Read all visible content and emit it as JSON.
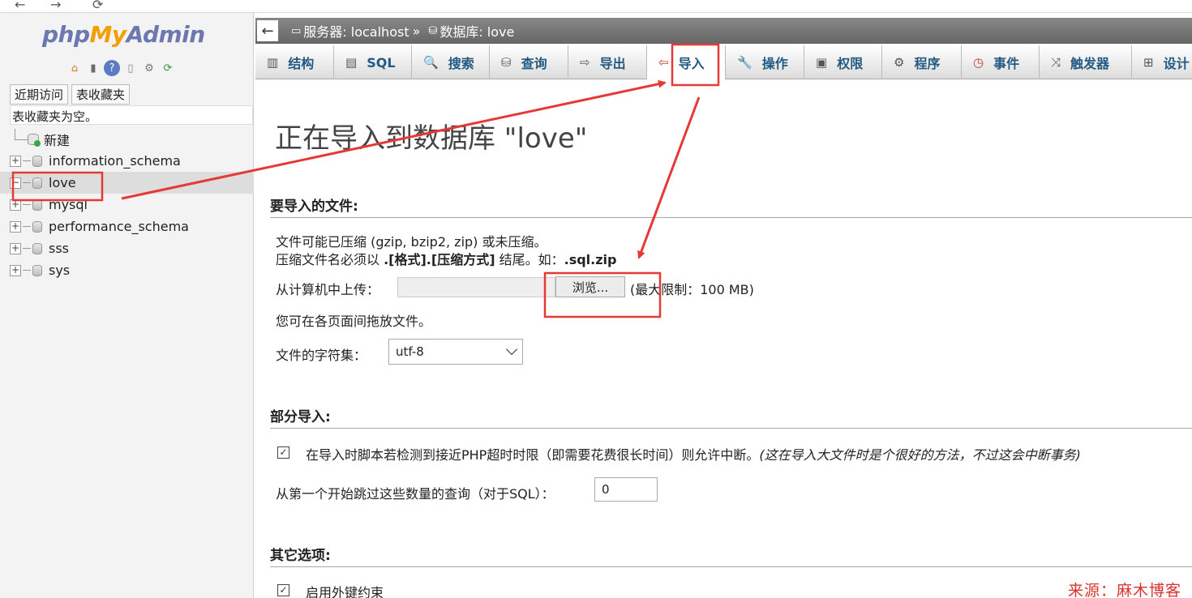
{
  "browser": {
    "back": "←",
    "forward": "→",
    "reload": "⟳"
  },
  "nav": {
    "logo": {
      "php": "php",
      "my": "My",
      "admin": "Admin"
    },
    "icons": [
      "home-icon",
      "logout-icon",
      "help-icon",
      "docs-icon",
      "settings-icon",
      "reload-icon"
    ],
    "tabs": [
      "近期访问",
      "表收藏夹"
    ],
    "favorites_empty": "表收藏夹为空。",
    "tree": [
      {
        "label": "新建",
        "type": "new"
      },
      {
        "label": "information_schema",
        "type": "db"
      },
      {
        "label": "love",
        "type": "db",
        "selected": true
      },
      {
        "label": "mysql",
        "type": "db"
      },
      {
        "label": "performance_schema",
        "type": "db"
      },
      {
        "label": "sss",
        "type": "db"
      },
      {
        "label": "sys",
        "type": "db"
      }
    ]
  },
  "breadcrumb": {
    "collapse": "←",
    "server": "服务器: localhost",
    "separator": "»",
    "database": "数据库: love"
  },
  "tabs": [
    {
      "label": "结构",
      "icon": "structure-icon",
      "glyph": "▥"
    },
    {
      "label": "SQL",
      "icon": "sql-icon",
      "glyph": "▤"
    },
    {
      "label": "搜索",
      "icon": "search-icon",
      "glyph": "🔍"
    },
    {
      "label": "查询",
      "icon": "query-icon",
      "glyph": "⛁"
    },
    {
      "label": "导出",
      "icon": "export-icon",
      "glyph": "⇨"
    },
    {
      "label": "导入",
      "icon": "import-icon",
      "glyph": "⇦",
      "active": true
    },
    {
      "label": "操作",
      "icon": "wrench-icon",
      "glyph": "🔧"
    },
    {
      "label": "权限",
      "icon": "privileges-icon",
      "glyph": "▣"
    },
    {
      "label": "程序",
      "icon": "routines-icon",
      "glyph": "⚙"
    },
    {
      "label": "事件",
      "icon": "events-icon",
      "glyph": "◷"
    },
    {
      "label": "触发器",
      "icon": "triggers-icon",
      "glyph": "⤨"
    },
    {
      "label": "设计",
      "icon": "designer-icon",
      "glyph": "⊞"
    }
  ],
  "content": {
    "title": "正在导入到数据库 \"love\"",
    "file_section": {
      "heading": "要导入的文件:",
      "line1": "文件可能已压缩 (gzip, bzip2, zip) 或未压缩。",
      "line2_prefix": "压缩文件名必须以 ",
      "line2_bold": ".[格式].[压缩方式]",
      "line2_mid": " 结尾。如：",
      "line2_example": ".sql.zip",
      "upload_label": "从计算机中上传：",
      "browse_button": "浏览...",
      "max_size": "(最大限制：100 MB)",
      "drag_hint": "您可在各页面间拖放文件。",
      "charset_label": "文件的字符集：",
      "charset_value": "utf-8"
    },
    "partial_section": {
      "heading": "部分导入:",
      "allow_interrupt": "在导入时脚本若检测到接近PHP超时时限（即需要花费很长时间）则允许中断。",
      "allow_interrupt_note": "(这在导入大文件时是个很好的方法，不过这会中断事务)",
      "allow_interrupt_checked": true,
      "skip_label": "从第一个开始跳过这些数量的查询（对于SQL）：",
      "skip_value": "0"
    },
    "other_section": {
      "heading": "其它选项:",
      "foreign_keys": "启用外键约束",
      "foreign_keys_checked": true
    }
  },
  "watermark": "来源：麻木博客",
  "colors": {
    "annotation": "#e53935",
    "tab_text": "#235a81",
    "logo_blue": "#6c78af",
    "logo_orange": "#f29f05"
  }
}
